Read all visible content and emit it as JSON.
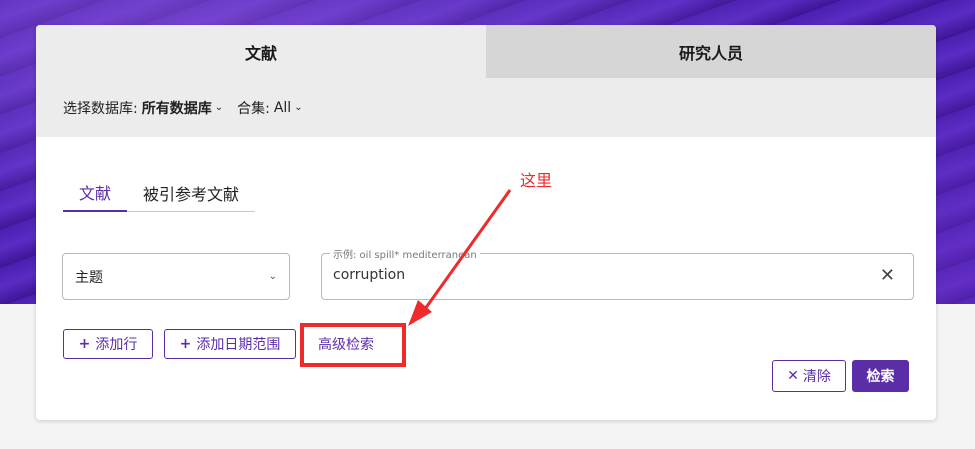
{
  "tabs": {
    "literature": "文献",
    "researchers": "研究人员"
  },
  "db_bar": {
    "select_label": "选择数据库:",
    "select_value": "所有数据库",
    "collection_label": "合集:",
    "collection_value": "All"
  },
  "sub_tabs": {
    "literature": "文献",
    "cited_refs": "被引参考文献"
  },
  "search": {
    "field": "主题",
    "placeholder": "示例: oil spill* mediterranean",
    "value": "corruption"
  },
  "buttons": {
    "add_row": "添加行",
    "add_date_range": "添加日期范围",
    "advanced_search": "高级检索",
    "clear": "清除",
    "search": "检索"
  },
  "annotation": {
    "label": "这里",
    "color": "#ee2a2a"
  },
  "colors": {
    "accent": "#5b2ea8",
    "banner": "#4a1fb0"
  }
}
